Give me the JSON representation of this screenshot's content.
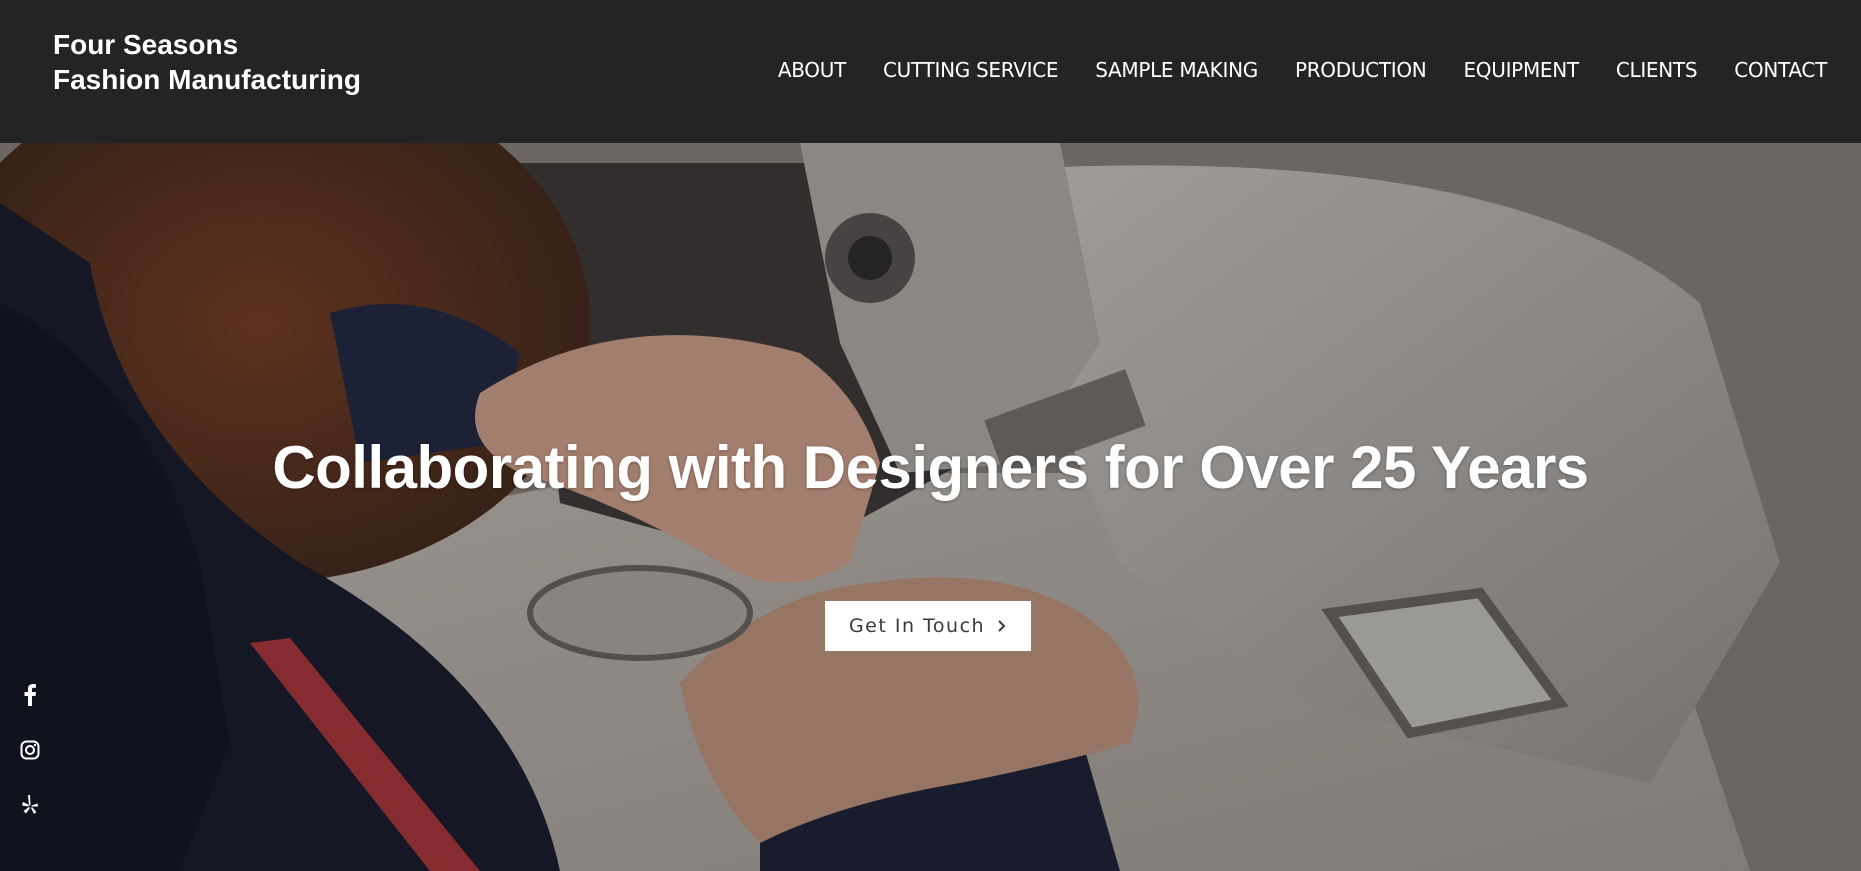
{
  "brand": {
    "line1": "Four Seasons",
    "line2": "Fashion Manufacturing"
  },
  "nav": {
    "items": [
      "ABOUT",
      "CUTTING SERVICE",
      "SAMPLE MAKING",
      "PRODUCTION",
      "EQUIPMENT",
      "CLIENTS",
      "CONTACT"
    ]
  },
  "hero": {
    "headline": "Collaborating with Designers for Over 25 Years",
    "cta_label": "Get In Touch",
    "cta_icon": "chevron-right-icon"
  },
  "social": {
    "icons": [
      "facebook-icon",
      "instagram-icon",
      "yelp-icon"
    ]
  },
  "colors": {
    "header_bg": "#242424",
    "text_light": "#ffffff",
    "button_bg": "#ffffff",
    "button_text": "#3a3a3a"
  }
}
